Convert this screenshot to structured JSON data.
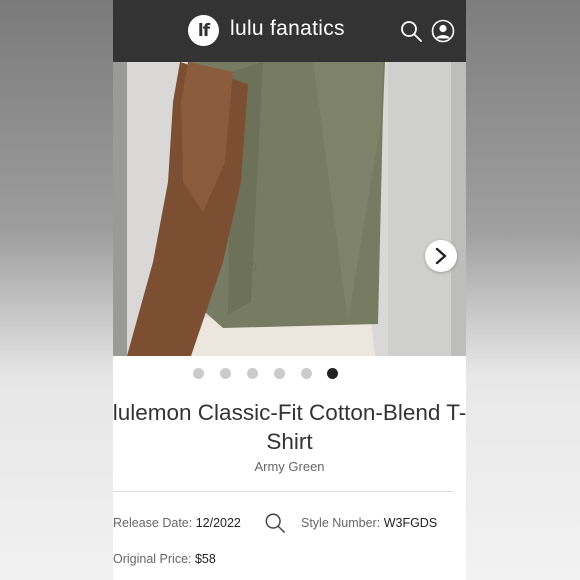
{
  "header": {
    "logo_text": "lf",
    "site_name": "lulu fanatics",
    "search_icon": "search-icon",
    "account_icon": "user-icon"
  },
  "carousel": {
    "image_subject": "Person wearing an army green cropped t-shirt, side view",
    "next_icon": "chevron-right-icon",
    "total_slides": 6,
    "active_slide": 6
  },
  "product": {
    "title": "lulemon Classic-Fit Cotton-Blend T-Shirt",
    "color": "Army Green"
  },
  "details": {
    "release_label": "Release Date:",
    "release_value": "12/2022",
    "style_label": "Style Number:",
    "style_value": "W3FGDS",
    "price_label": "Original Price:",
    "price_value": "$58"
  },
  "colors": {
    "header_bg": "#333333",
    "shirt": "#767b61",
    "active_dot": "#222222",
    "inactive_dot": "#cbcbcb"
  }
}
